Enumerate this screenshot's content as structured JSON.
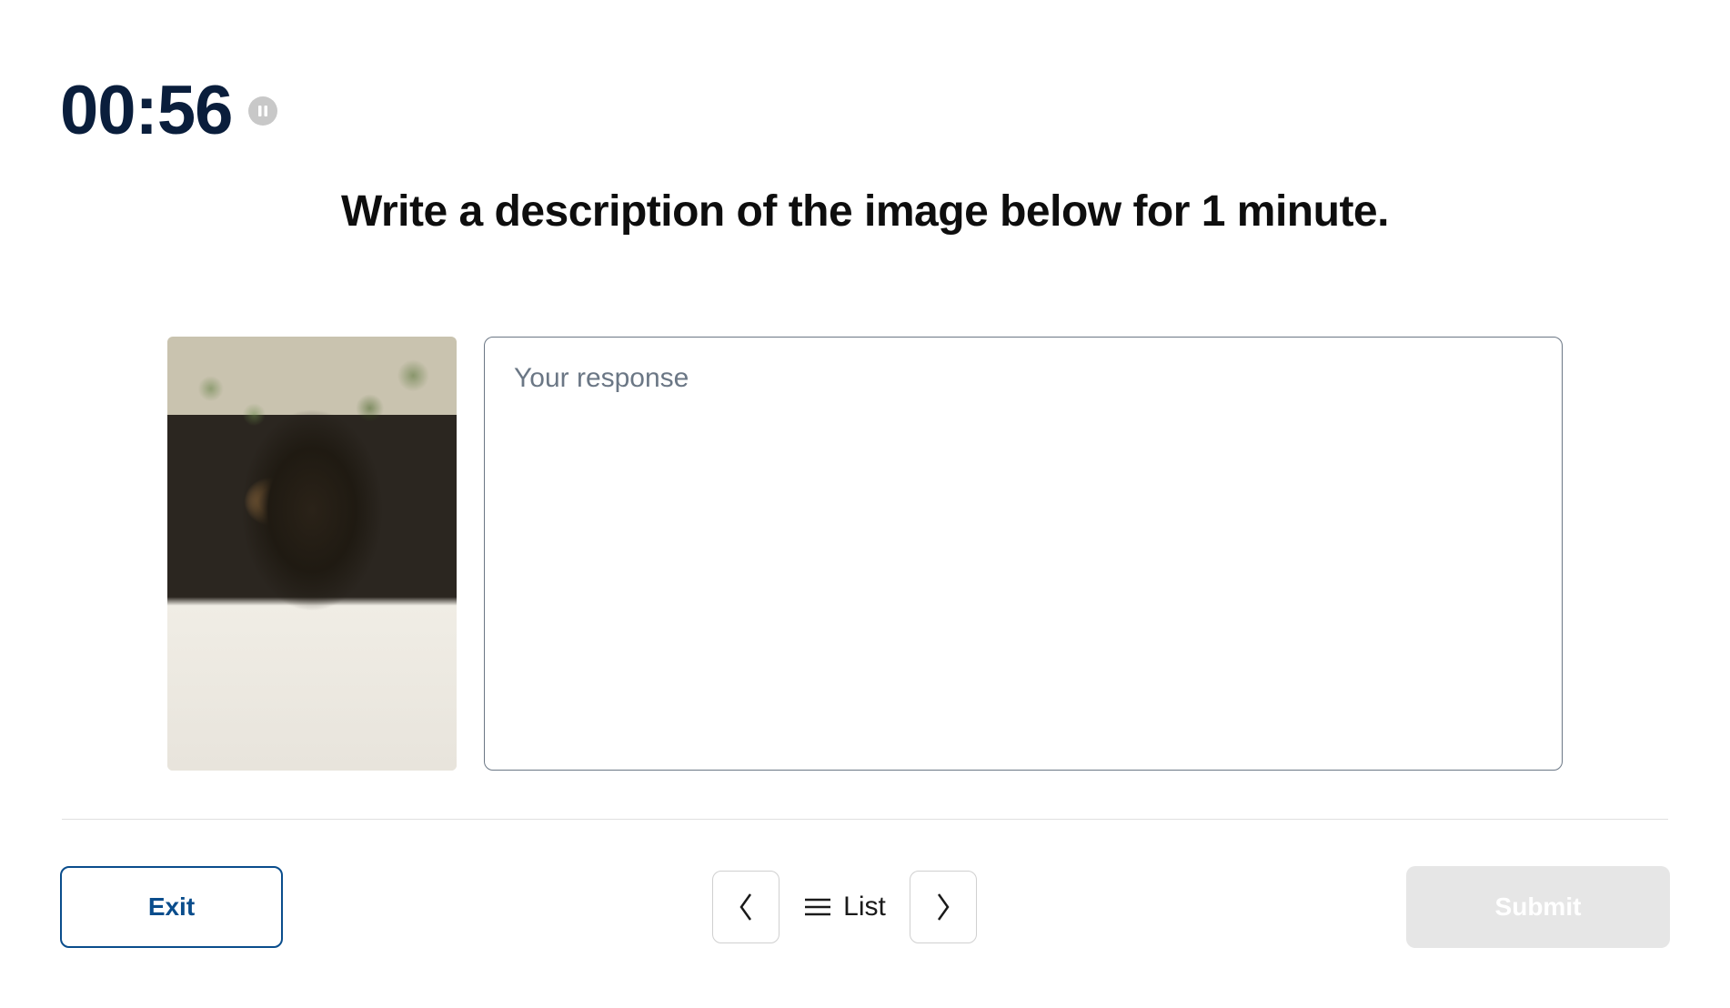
{
  "timer": {
    "value": "00:56"
  },
  "prompt": {
    "text": "Write a description of the image below for 1 minute."
  },
  "response": {
    "placeholder": "Your response",
    "value": ""
  },
  "footer": {
    "exit_label": "Exit",
    "list_label": "List",
    "submit_label": "Submit"
  }
}
